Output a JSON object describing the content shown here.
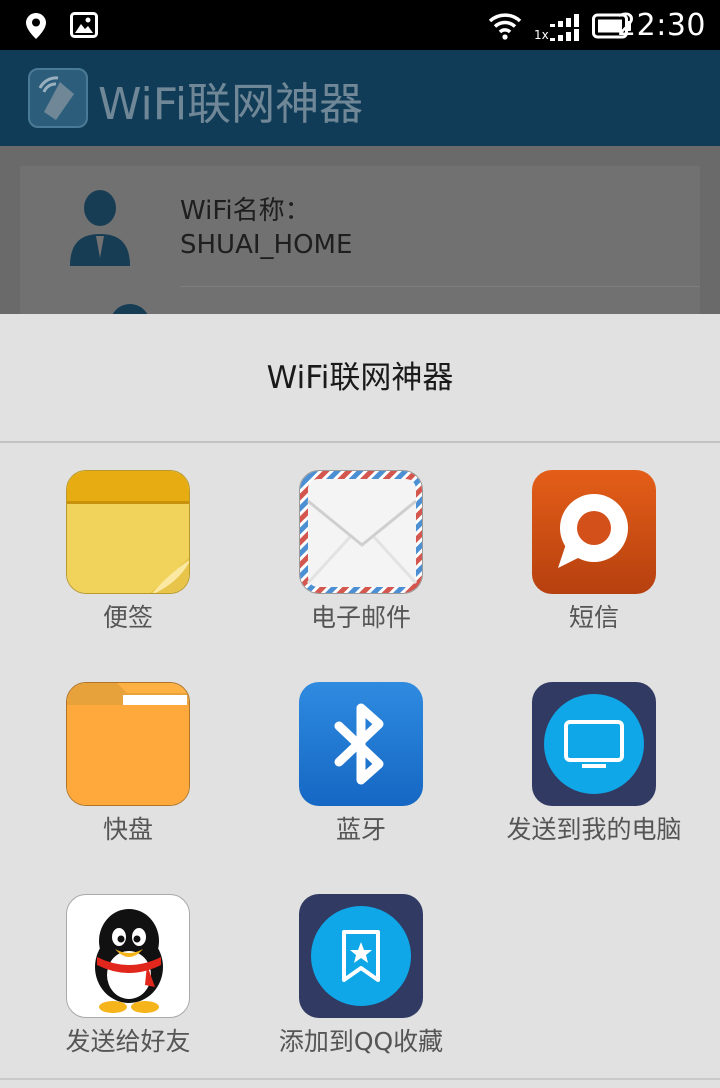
{
  "status_bar": {
    "time": "22:30",
    "network_label": "1x",
    "icons": [
      "location-icon",
      "image-notification-icon",
      "wifi-icon",
      "signal-icon",
      "battery-icon"
    ]
  },
  "app_bar": {
    "title": "WiFi联网神器"
  },
  "content": {
    "wifi_label": "WiFi名称：",
    "wifi_value": "SHUAI_HOME"
  },
  "share_sheet": {
    "title": "WiFi联网神器",
    "items": [
      {
        "label": "便签",
        "icon": "notes-icon"
      },
      {
        "label": "电子邮件",
        "icon": "email-icon"
      },
      {
        "label": "短信",
        "icon": "sms-icon"
      },
      {
        "label": "快盘",
        "icon": "folder-icon"
      },
      {
        "label": "蓝牙",
        "icon": "bluetooth-icon"
      },
      {
        "label": "发送到我的电脑",
        "icon": "send-to-pc-icon"
      },
      {
        "label": "发送给好友",
        "icon": "qq-icon"
      },
      {
        "label": "添加到QQ收藏",
        "icon": "qq-favorites-icon"
      }
    ]
  },
  "colors": {
    "app_bar": "#113c57",
    "sheet_bg": "#e1e1e1",
    "qq_blue": "#0fa7e7"
  }
}
